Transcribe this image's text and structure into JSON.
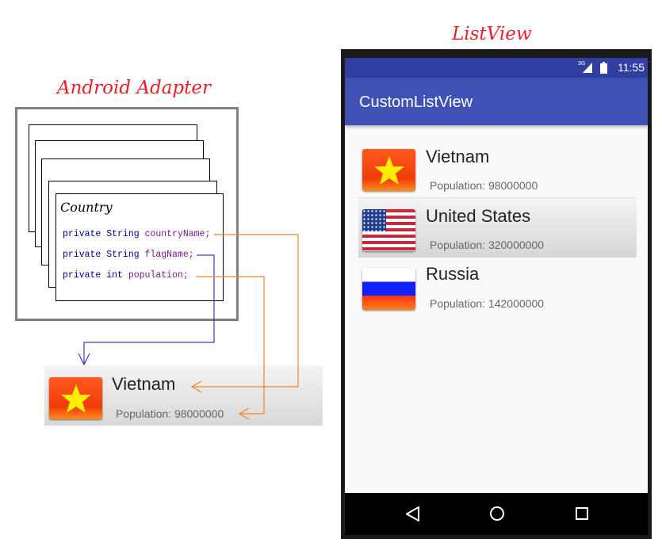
{
  "diagram": {
    "adapter_title": "Android Adapter",
    "listview_title": "ListView",
    "class_name": "Country",
    "fields": [
      {
        "mod": "private",
        "type": "String",
        "name": "countryName;"
      },
      {
        "mod": "private",
        "type": "String",
        "name": "flagName;"
      },
      {
        "mod": "private",
        "type": "int",
        "name": "population;"
      }
    ],
    "sample_item": {
      "name": "Vietnam",
      "population": "Population: 98000000"
    },
    "colors": {
      "arrow_orange": "#f5822a",
      "arrow_blue": "#3a3ad0",
      "title_red": "#e8202a"
    }
  },
  "phone": {
    "status": {
      "network": "3G",
      "time": "11:55"
    },
    "app_title": "CustomListView",
    "items": [
      {
        "name": "Vietnam",
        "population": "Population: 98000000",
        "flag": "vietnam-flag"
      },
      {
        "name": "United States",
        "population": "Population: 320000000",
        "flag": "usa-flag"
      },
      {
        "name": "Russia",
        "population": "Population: 142000000",
        "flag": "russia-flag"
      }
    ],
    "nav": [
      "back-icon",
      "home-icon",
      "recents-icon"
    ]
  }
}
